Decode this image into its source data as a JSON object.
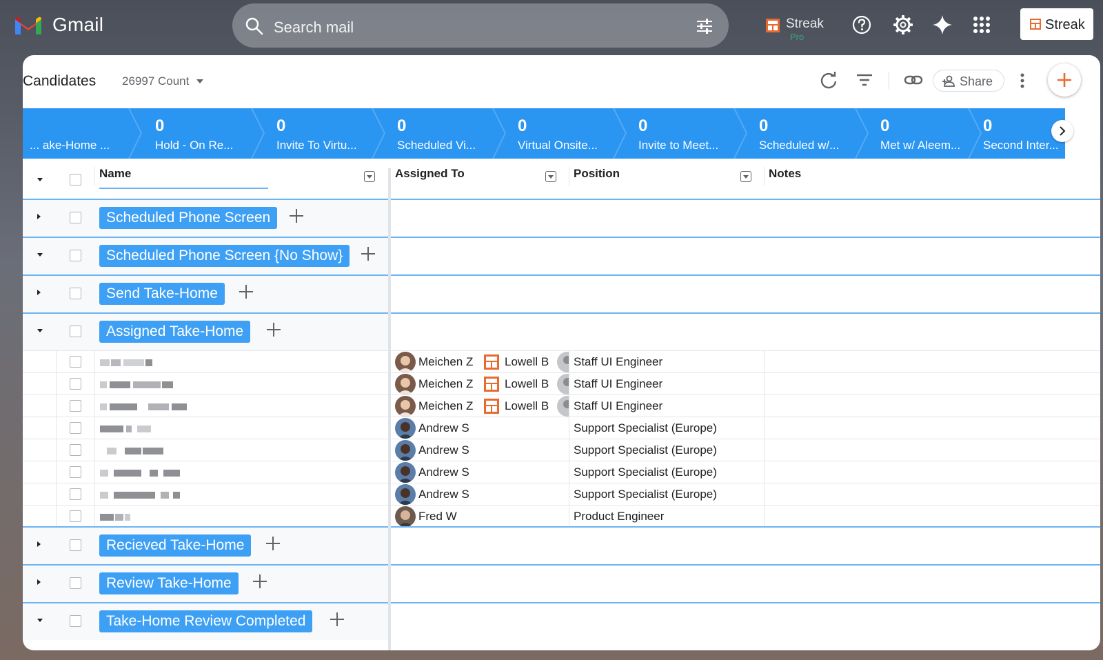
{
  "topbar": {
    "app_name": "Gmail",
    "search_placeholder": "Search mail",
    "streak_label": "Streak",
    "streak_sub": "Pro",
    "streak_button": "Streak"
  },
  "header": {
    "title": "Candidates",
    "count": "26997 Count",
    "share_label": "Share"
  },
  "stages": [
    {
      "count": "",
      "name": "... ake-Home ..."
    },
    {
      "count": "0",
      "name": "Hold - On Re..."
    },
    {
      "count": "0",
      "name": "Invite To Virtu..."
    },
    {
      "count": "0",
      "name": "Scheduled Vi..."
    },
    {
      "count": "0",
      "name": "Virtual Onsite..."
    },
    {
      "count": "0",
      "name": "Invite to Meet..."
    },
    {
      "count": "0",
      "name": "Scheduled w/..."
    },
    {
      "count": "0",
      "name": "Met w/ Aleem..."
    },
    {
      "count": "0",
      "name": "Second Inter..."
    }
  ],
  "columns": {
    "name": "Name",
    "assigned": "Assigned To",
    "position": "Position",
    "notes": "Notes"
  },
  "groups": [
    {
      "label": "Scheduled Phone Screen",
      "expanded": false
    },
    {
      "label": "Scheduled Phone Screen {No Show}",
      "expanded": true
    },
    {
      "label": "Send Take-Home",
      "expanded": false
    },
    {
      "label": "Assigned Take-Home",
      "expanded": true
    },
    {
      "label": "Recieved Take-Home",
      "expanded": false
    },
    {
      "label": "Review Take-Home",
      "expanded": false
    },
    {
      "label": "Take-Home Review Completed",
      "expanded": true
    }
  ],
  "rows": [
    {
      "assignee": "Meichen Z",
      "second": "Lowell B",
      "position": "Staff UI Engineer"
    },
    {
      "assignee": "Meichen Z",
      "second": "Lowell B",
      "position": "Staff UI Engineer"
    },
    {
      "assignee": "Meichen Z",
      "second": "Lowell B",
      "position": "Staff UI Engineer"
    },
    {
      "assignee": "Andrew S",
      "second": "",
      "position": "Support Specialist (Europe)"
    },
    {
      "assignee": "Andrew S",
      "second": "",
      "position": "Support Specialist (Europe)"
    },
    {
      "assignee": "Andrew S",
      "second": "",
      "position": "Support Specialist (Europe)"
    },
    {
      "assignee": "Andrew S",
      "second": "",
      "position": "Support Specialist (Europe)"
    },
    {
      "assignee": "Fred W",
      "second": "",
      "position": "Product Engineer"
    }
  ],
  "colors": {
    "stage_bar": "#2b95f2",
    "group_tag": "#3ea0f4",
    "accent_orange": "#ea6a2e"
  }
}
